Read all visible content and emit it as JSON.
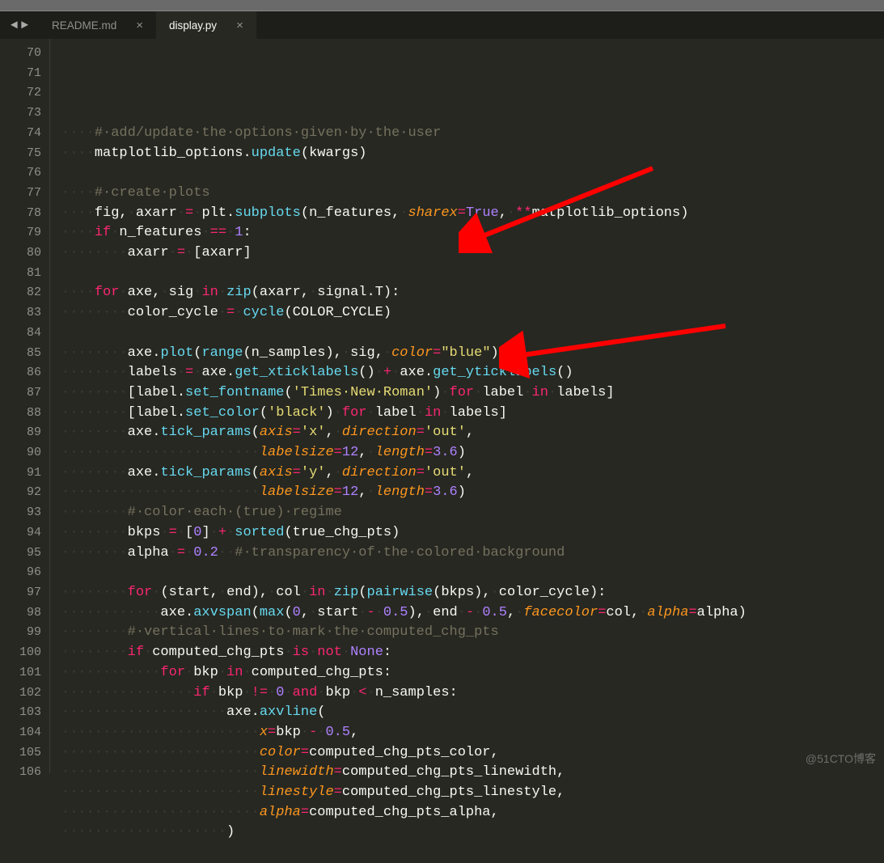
{
  "tabs": [
    {
      "label": "README.md",
      "active": false
    },
    {
      "label": "display.py",
      "active": true
    }
  ],
  "first_line_number": 70,
  "lines": [
    [
      [
        "ws",
        "····"
      ],
      [
        "cm",
        "#·add/update·the·options·given·by·the·user"
      ]
    ],
    [
      [
        "ws",
        "····"
      ],
      [
        "tx",
        "matplotlib_options"
      ],
      [
        "tx",
        "."
      ],
      [
        "fn",
        "update"
      ],
      [
        "tx",
        "(kwargs)"
      ]
    ],
    [],
    [
      [
        "ws",
        "····"
      ],
      [
        "cm",
        "#·create·plots"
      ]
    ],
    [
      [
        "ws",
        "····"
      ],
      [
        "tx",
        "fig,"
      ],
      [
        "ws",
        "·"
      ],
      [
        "tx",
        "axarr"
      ],
      [
        "ws",
        "·"
      ],
      [
        "op",
        "="
      ],
      [
        "ws",
        "·"
      ],
      [
        "tx",
        "plt."
      ],
      [
        "fn",
        "subplots"
      ],
      [
        "tx",
        "(n_features,"
      ],
      [
        "ws",
        "·"
      ],
      [
        "ar",
        "sharex"
      ],
      [
        "op",
        "="
      ],
      [
        "nm",
        "True"
      ],
      [
        "tx",
        "],"
      ],
      [
        "ws",
        "·"
      ],
      [
        "op",
        "**"
      ],
      [
        "tx",
        "matplotlib_options)"
      ]
    ],
    [
      [
        "ws",
        "····"
      ],
      [
        "kw",
        "if"
      ],
      [
        "ws",
        "·"
      ],
      [
        "tx",
        "n_features"
      ],
      [
        "ws",
        "·"
      ],
      [
        "op",
        "=="
      ],
      [
        "ws",
        "·"
      ],
      [
        "nm",
        "1"
      ],
      [
        "tx",
        ":"
      ]
    ],
    [
      [
        "ws",
        "········"
      ],
      [
        "tx",
        "axarr"
      ],
      [
        "ws",
        "·"
      ],
      [
        "op",
        "="
      ],
      [
        "ws",
        "·"
      ],
      [
        "tx",
        "[axarr]"
      ]
    ],
    [],
    [
      [
        "ws",
        "····"
      ],
      [
        "kw",
        "for"
      ],
      [
        "ws",
        "·"
      ],
      [
        "tx",
        "axe,"
      ],
      [
        "ws",
        "·"
      ],
      [
        "tx",
        "sig"
      ],
      [
        "ws",
        "·"
      ],
      [
        "kw",
        "in"
      ],
      [
        "ws",
        "·"
      ],
      [
        "fn",
        "zip"
      ],
      [
        "tx",
        "(axarr,"
      ],
      [
        "ws",
        "·"
      ],
      [
        "tx",
        "signal.T):"
      ]
    ],
    [
      [
        "ws",
        "········"
      ],
      [
        "tx",
        "color_cycle"
      ],
      [
        "ws",
        "·"
      ],
      [
        "op",
        "="
      ],
      [
        "ws",
        "·"
      ],
      [
        "fn",
        "cycle"
      ],
      [
        "tx",
        "(COLOR_CYCLE)"
      ]
    ],
    [],
    [
      [
        "ws",
        "········"
      ],
      [
        "tx",
        "axe."
      ],
      [
        "fn",
        "plot"
      ],
      [
        "tx",
        "("
      ],
      [
        "fn",
        "range"
      ],
      [
        "tx",
        "(n_samples),"
      ],
      [
        "ws",
        "·"
      ],
      [
        "tx",
        "sig,"
      ],
      [
        "ws",
        "·"
      ],
      [
        "ar",
        "color"
      ],
      [
        "op",
        "="
      ],
      [
        "st",
        "\"blue\""
      ],
      [
        "tx",
        ")"
      ]
    ],
    [
      [
        "ws",
        "········"
      ],
      [
        "tx",
        "labels"
      ],
      [
        "ws",
        "·"
      ],
      [
        "op",
        "="
      ],
      [
        "ws",
        "·"
      ],
      [
        "tx",
        "axe."
      ],
      [
        "fn",
        "get_xticklabels"
      ],
      [
        "tx",
        "()"
      ],
      [
        "ws",
        "·"
      ],
      [
        "op",
        "+"
      ],
      [
        "ws",
        "·"
      ],
      [
        "tx",
        "axe."
      ],
      [
        "fn",
        "get_yticklabels"
      ],
      [
        "tx",
        "()"
      ]
    ],
    [
      [
        "ws",
        "········"
      ],
      [
        "tx",
        "[label."
      ],
      [
        "fn",
        "set_fontname"
      ],
      [
        "tx",
        "("
      ],
      [
        "st",
        "'Times·New·Roman'"
      ],
      [
        "tx",
        ")"
      ],
      [
        "ws",
        "·"
      ],
      [
        "kw",
        "for"
      ],
      [
        "ws",
        "·"
      ],
      [
        "tx",
        "label"
      ],
      [
        "ws",
        "·"
      ],
      [
        "kw",
        "in"
      ],
      [
        "ws",
        "·"
      ],
      [
        "tx",
        "labels]"
      ]
    ],
    [
      [
        "ws",
        "········"
      ],
      [
        "tx",
        "[label."
      ],
      [
        "fn",
        "set_color"
      ],
      [
        "tx",
        "("
      ],
      [
        "st",
        "'black'"
      ],
      [
        "tx",
        ")"
      ],
      [
        "ws",
        "·"
      ],
      [
        "kw",
        "for"
      ],
      [
        "ws",
        "·"
      ],
      [
        "tx",
        "label"
      ],
      [
        "ws",
        "·"
      ],
      [
        "kw",
        "in"
      ],
      [
        "ws",
        "·"
      ],
      [
        "tx",
        "labels]"
      ]
    ],
    [
      [
        "ws",
        "········"
      ],
      [
        "tx",
        "axe."
      ],
      [
        "fn",
        "tick_params"
      ],
      [
        "tx",
        "("
      ],
      [
        "ar",
        "axis"
      ],
      [
        "op",
        "="
      ],
      [
        "st",
        "'x'"
      ],
      [
        "tx",
        "],"
      ],
      [
        "ws",
        "·"
      ],
      [
        "ar",
        "direction"
      ],
      [
        "op",
        "="
      ],
      [
        "st",
        "'out'"
      ],
      [
        "tx",
        "],"
      ]
    ],
    [
      [
        "ws",
        "························"
      ],
      [
        "ar",
        "labelsize"
      ],
      [
        "op",
        "="
      ],
      [
        "nm",
        "12"
      ],
      [
        "tx",
        "],"
      ],
      [
        "ws",
        "·"
      ],
      [
        "ar",
        "length"
      ],
      [
        "op",
        "="
      ],
      [
        "nm",
        "3.6"
      ],
      [
        "tx",
        ")"
      ]
    ],
    [
      [
        "ws",
        "········"
      ],
      [
        "tx",
        "axe."
      ],
      [
        "fn",
        "tick_params"
      ],
      [
        "tx",
        "("
      ],
      [
        "ar",
        "axis"
      ],
      [
        "op",
        "="
      ],
      [
        "st",
        "'y'"
      ],
      [
        "tx",
        "],"
      ],
      [
        "ws",
        "·"
      ],
      [
        "ar",
        "direction"
      ],
      [
        "op",
        "="
      ],
      [
        "st",
        "'out'"
      ],
      [
        "tx",
        "],"
      ]
    ],
    [
      [
        "ws",
        "························"
      ],
      [
        "ar",
        "labelsize"
      ],
      [
        "op",
        "="
      ],
      [
        "nm",
        "12"
      ],
      [
        "tx",
        "],"
      ],
      [
        "ws",
        "·"
      ],
      [
        "ar",
        "length"
      ],
      [
        "op",
        "="
      ],
      [
        "nm",
        "3.6"
      ],
      [
        "tx",
        ")"
      ]
    ],
    [
      [
        "ws",
        "········"
      ],
      [
        "cm",
        "#·color·each·(true)·regime"
      ]
    ],
    [
      [
        "ws",
        "········"
      ],
      [
        "tx",
        "bkps"
      ],
      [
        "ws",
        "·"
      ],
      [
        "op",
        "="
      ],
      [
        "ws",
        "·"
      ],
      [
        "tx",
        "["
      ],
      [
        "nm",
        "0"
      ],
      [
        "tx",
        "]"
      ],
      [
        "ws",
        "·"
      ],
      [
        "op",
        "+"
      ],
      [
        "ws",
        "·"
      ],
      [
        "fn",
        "sorted"
      ],
      [
        "tx",
        "(true_chg_pts)"
      ]
    ],
    [
      [
        "ws",
        "········"
      ],
      [
        "tx",
        "alpha"
      ],
      [
        "ws",
        "·"
      ],
      [
        "op",
        "="
      ],
      [
        "ws",
        "·"
      ],
      [
        "nm",
        "0.2"
      ],
      [
        "ws",
        "··"
      ],
      [
        "cm",
        "#·transparency·of·the·colored·background"
      ]
    ],
    [],
    [
      [
        "ws",
        "········"
      ],
      [
        "kw",
        "for"
      ],
      [
        "ws",
        "·"
      ],
      [
        "tx",
        "(start,"
      ],
      [
        "ws",
        "·"
      ],
      [
        "tx",
        "end),"
      ],
      [
        "ws",
        "·"
      ],
      [
        "tx",
        "col"
      ],
      [
        "ws",
        "·"
      ],
      [
        "kw",
        "in"
      ],
      [
        "ws",
        "·"
      ],
      [
        "fn",
        "zip"
      ],
      [
        "tx",
        "("
      ],
      [
        "fn",
        "pairwise"
      ],
      [
        "tx",
        "(bkps),"
      ],
      [
        "ws",
        "·"
      ],
      [
        "tx",
        "color_cycle):"
      ]
    ],
    [
      [
        "ws",
        "············"
      ],
      [
        "tx",
        "axe."
      ],
      [
        "fn",
        "axvspan"
      ],
      [
        "tx",
        "("
      ],
      [
        "fn",
        "max"
      ],
      [
        "tx",
        "("
      ],
      [
        "nm",
        "0"
      ],
      [
        "tx",
        "],"
      ],
      [
        "ws",
        "·"
      ],
      [
        "tx",
        "start"
      ],
      [
        "ws",
        "·"
      ],
      [
        "op",
        "-"
      ],
      [
        "ws",
        "·"
      ],
      [
        "nm",
        "0.5"
      ],
      [
        "tx",
        "),"
      ],
      [
        "ws",
        "·"
      ],
      [
        "tx",
        "end"
      ],
      [
        "ws",
        "·"
      ],
      [
        "op",
        "-"
      ],
      [
        "ws",
        "·"
      ],
      [
        "nm",
        "0.5"
      ],
      [
        "tx",
        "],"
      ],
      [
        "ws",
        "·"
      ],
      [
        "ar",
        "facecolor"
      ],
      [
        "op",
        "="
      ],
      [
        "tx",
        "col,"
      ],
      [
        "ws",
        "·"
      ],
      [
        "ar",
        "alpha"
      ],
      [
        "op",
        "="
      ],
      [
        "tx",
        "alpha)"
      ]
    ],
    [
      [
        "ws",
        "········"
      ],
      [
        "cm",
        "#·vertical·lines·to·mark·the·computed_chg_pts"
      ]
    ],
    [
      [
        "ws",
        "········"
      ],
      [
        "kw",
        "if"
      ],
      [
        "ws",
        "·"
      ],
      [
        "tx",
        "computed_chg_pts"
      ],
      [
        "ws",
        "·"
      ],
      [
        "kw",
        "is"
      ],
      [
        "ws",
        "·"
      ],
      [
        "kw",
        "not"
      ],
      [
        "ws",
        "·"
      ],
      [
        "nm",
        "None"
      ],
      [
        "tx",
        ":"
      ]
    ],
    [
      [
        "ws",
        "············"
      ],
      [
        "kw",
        "for"
      ],
      [
        "ws",
        "·"
      ],
      [
        "tx",
        "bkp"
      ],
      [
        "ws",
        "·"
      ],
      [
        "kw",
        "in"
      ],
      [
        "ws",
        "·"
      ],
      [
        "tx",
        "computed_chg_pts:"
      ]
    ],
    [
      [
        "ws",
        "················"
      ],
      [
        "kw",
        "if"
      ],
      [
        "ws",
        "·"
      ],
      [
        "tx",
        "bkp"
      ],
      [
        "ws",
        "·"
      ],
      [
        "op",
        "!="
      ],
      [
        "ws",
        "·"
      ],
      [
        "nm",
        "0"
      ],
      [
        "ws",
        "·"
      ],
      [
        "kw",
        "and"
      ],
      [
        "ws",
        "·"
      ],
      [
        "tx",
        "bkp"
      ],
      [
        "ws",
        "·"
      ],
      [
        "op",
        "<"
      ],
      [
        "ws",
        "·"
      ],
      [
        "tx",
        "n_samples:"
      ]
    ],
    [
      [
        "ws",
        "····················"
      ],
      [
        "tx",
        "axe."
      ],
      [
        "fn",
        "axvline"
      ],
      [
        "tx",
        "("
      ]
    ],
    [
      [
        "ws",
        "························"
      ],
      [
        "ar",
        "x"
      ],
      [
        "op",
        "="
      ],
      [
        "tx",
        "bkp"
      ],
      [
        "ws",
        "·"
      ],
      [
        "op",
        "-"
      ],
      [
        "ws",
        "·"
      ],
      [
        "nm",
        "0.5"
      ],
      [
        "tx",
        "], "
      ]
    ],
    [
      [
        "ws",
        "························"
      ],
      [
        "ar",
        "color"
      ],
      [
        "op",
        "="
      ],
      [
        "tx",
        "computed_chg_pts_color,"
      ]
    ],
    [
      [
        "ws",
        "························"
      ],
      [
        "ar",
        "linewidth"
      ],
      [
        "op",
        "="
      ],
      [
        "tx",
        "computed_chg_pts_linewidth,"
      ]
    ],
    [
      [
        "ws",
        "························"
      ],
      [
        "ar",
        "linestyle"
      ],
      [
        "op",
        "="
      ],
      [
        "tx",
        "computed_chg_pts_linestyle,"
      ]
    ],
    [
      [
        "ws",
        "························"
      ],
      [
        "ar",
        "alpha"
      ],
      [
        "op",
        "="
      ],
      [
        "tx",
        "computed_chg_pts_alpha,"
      ]
    ],
    [
      [
        "ws",
        "····················"
      ],
      [
        "tx",
        ")"
      ]
    ],
    []
  ],
  "watermark": "@51CTO博客"
}
